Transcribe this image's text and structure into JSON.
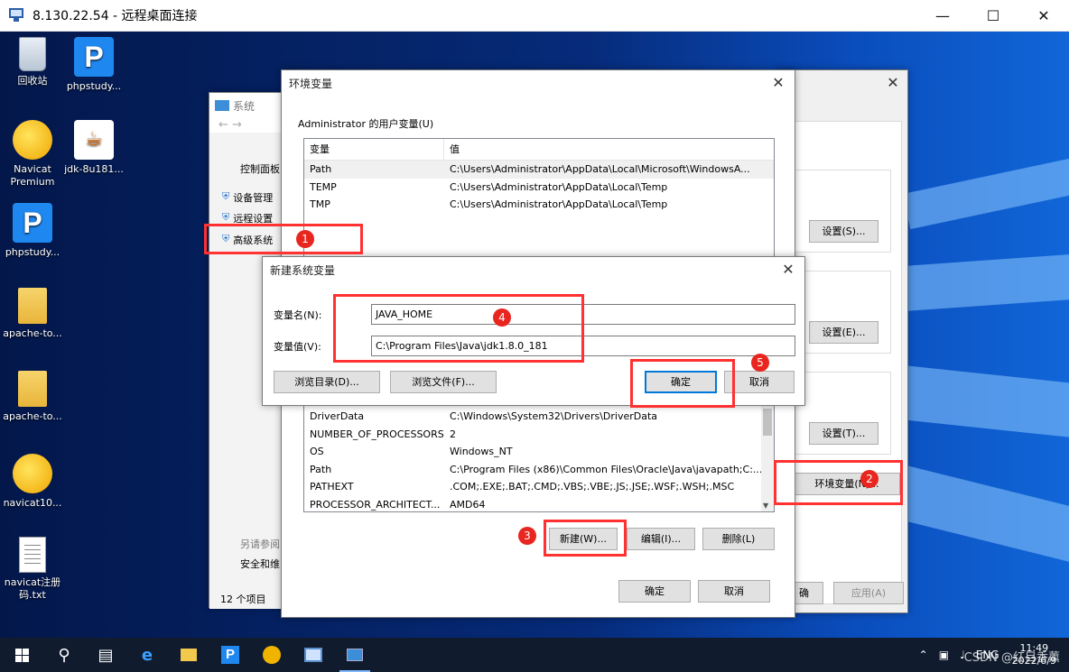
{
  "rdp": {
    "title": "8.130.22.54 - 远程桌面连接"
  },
  "desktop_icons": [
    {
      "label": "回收站",
      "icon": "recycle-bin-icon"
    },
    {
      "label": "phpstudy...",
      "icon": "phpstudy-icon"
    },
    {
      "label": "Navicat Premium",
      "icon": "navicat-icon"
    },
    {
      "label": "jdk-8u181...",
      "icon": "java-icon"
    },
    {
      "label": "phpstudy...",
      "icon": "phpstudy-icon"
    },
    {
      "label": "apache-to...",
      "icon": "folder-icon"
    },
    {
      "label": "apache-to...",
      "icon": "zip-folder-icon"
    },
    {
      "label": "navicat10...",
      "icon": "navicat-icon"
    },
    {
      "label": "navicat注册码.txt",
      "icon": "text-file-icon"
    }
  ],
  "system_window": {
    "title": "系统",
    "nav": [
      "控制面板",
      "设备管理",
      "远程设置",
      "高级系统"
    ],
    "see_also": "另请参阅",
    "security": "安全和维",
    "status": "12 个项目"
  },
  "sysprops": {
    "settings_btns": [
      "设置(S)...",
      "设置(E)...",
      "设置(T)..."
    ],
    "env_btn": "环境变量(N)...",
    "ok": "确",
    "apply": "应用(A)"
  },
  "env_dialog": {
    "title": "环境变量",
    "user_group": "Administrator 的用户变量(U)",
    "col_var": "变量",
    "col_val": "值",
    "user_vars": [
      {
        "name": "Path",
        "value": "C:\\Users\\Administrator\\AppData\\Local\\Microsoft\\WindowsA..."
      },
      {
        "name": "TEMP",
        "value": "C:\\Users\\Administrator\\AppData\\Local\\Temp"
      },
      {
        "name": "TMP",
        "value": "C:\\Users\\Administrator\\AppData\\Local\\Temp"
      }
    ],
    "sys_vars": [
      {
        "name": "DriverData",
        "value": "C:\\Windows\\System32\\Drivers\\DriverData"
      },
      {
        "name": "NUMBER_OF_PROCESSORS",
        "value": "2"
      },
      {
        "name": "OS",
        "value": "Windows_NT"
      },
      {
        "name": "Path",
        "value": "C:\\Program Files (x86)\\Common Files\\Oracle\\Java\\javapath;C:..."
      },
      {
        "name": "PATHEXT",
        "value": ".COM;.EXE;.BAT;.CMD;.VBS;.VBE;.JS;.JSE;.WSF;.WSH;.MSC"
      },
      {
        "name": "PROCESSOR_ARCHITECT...",
        "value": "AMD64"
      }
    ],
    "new_btn": "新建(W)...",
    "edit_btn": "编辑(I)...",
    "delete_btn": "删除(L)",
    "ok": "确定",
    "cancel": "取消"
  },
  "new_var_dialog": {
    "title": "新建系统变量",
    "name_label": "变量名(N):",
    "value_label": "变量值(V):",
    "name_value": "JAVA_HOME",
    "value_value": "C:\\Program Files\\Java\\jdk1.8.0_181",
    "browse_dir": "浏览目录(D)...",
    "browse_file": "浏览文件(F)...",
    "ok": "确定",
    "cancel": "取消"
  },
  "annotations": [
    "1",
    "2",
    "3",
    "4",
    "5"
  ],
  "taskbar": {
    "lang": "ENG",
    "time": "11:49",
    "date": "2022/6/9",
    "watermark": "CSDN @红目香薰"
  },
  "colors": {
    "annotation_red": "#ff3131",
    "badge_red": "#e8251e",
    "accent_blue": "#0078d7"
  }
}
